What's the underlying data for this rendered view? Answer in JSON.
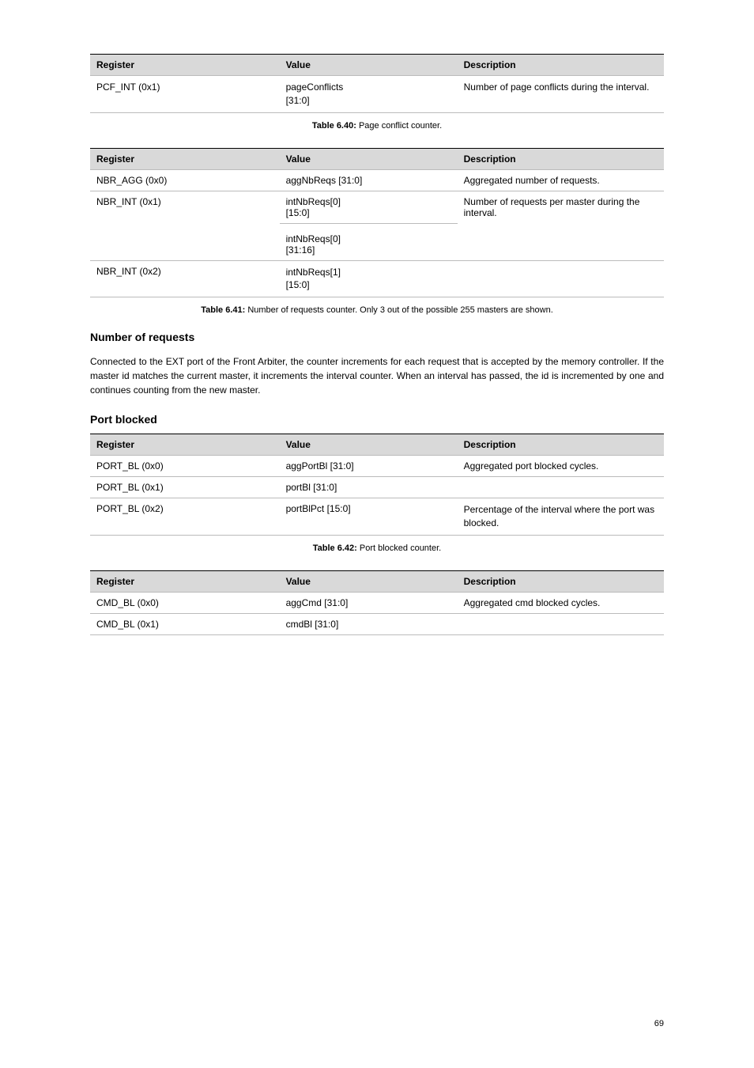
{
  "tables": {
    "t1": {
      "headers": [
        "Register",
        "Value",
        "Description"
      ],
      "rows": [
        {
          "c0": "PCF_INT (0x1)",
          "c1": "pageConflicts\n[31:0]",
          "c2": "Number of page conflicts during the interval."
        }
      ]
    },
    "t2": {
      "caption_num": "Table 6.40:",
      "caption_text": "Page conflict counter.",
      "headers": [
        "Register",
        "Value",
        "Description"
      ],
      "rows": [
        {
          "c0": "NBR_AGG (0x0)",
          "c1": "aggNbReqs [31:0]",
          "c2": "Aggregated number of requests."
        },
        {
          "c0": "NBR_INT (0x1)",
          "c1a": "intNbReqs[0]\n[15:0]",
          "c1b": "intNbReqs[0]\n[31:16]",
          "c2": "Number of requests per master during the interval."
        },
        {
          "c0": "NBR_INT (0x2)",
          "c1": "intNbReqs[1]\n[15:0]",
          "c2": ""
        }
      ]
    },
    "t3": {
      "caption_num": "Table 6.41:",
      "caption_text": "Number of requests counter. Only 3 out of the possible 255 masters are shown.",
      "headers": [
        "Register",
        "Value",
        "Description"
      ],
      "rows": [
        {
          "c0": "PORT_BL (0x0)",
          "c1": "aggPortBl [31:0]",
          "c2": "Aggregated port blocked cycles."
        },
        {
          "c0": "PORT_BL (0x1)",
          "c1": "portBl [31:0]",
          "c2": ""
        },
        {
          "c0": "PORT_BL (0x2)",
          "c1": "portBlPct [15:0]",
          "c2": "Percentage of the interval where the port was blocked."
        }
      ]
    },
    "t4": {
      "caption_num": "Table 6.42:",
      "caption_text": "Port blocked counter.",
      "headers": [
        "Register",
        "Value",
        "Description"
      ],
      "rows": [
        {
          "c0": "CMD_BL (0x0)",
          "c1": "aggCmd [31:0]",
          "c2": "Aggregated cmd blocked cycles."
        },
        {
          "c0": "CMD_BL (0x1)",
          "c1": "cmdBl [31:0]",
          "c2": ""
        }
      ]
    }
  },
  "section": {
    "heading": "Number of requests",
    "paragraph": "Connected to the EXT port of the Front Arbiter, the counter increments for each request that is accepted by the memory controller. If the master id matches the current master, it increments the interval counter. When an interval has passed, the id is incremented by one and continues counting from the new master."
  },
  "section2": {
    "heading": "Port blocked"
  },
  "page_number": "69"
}
